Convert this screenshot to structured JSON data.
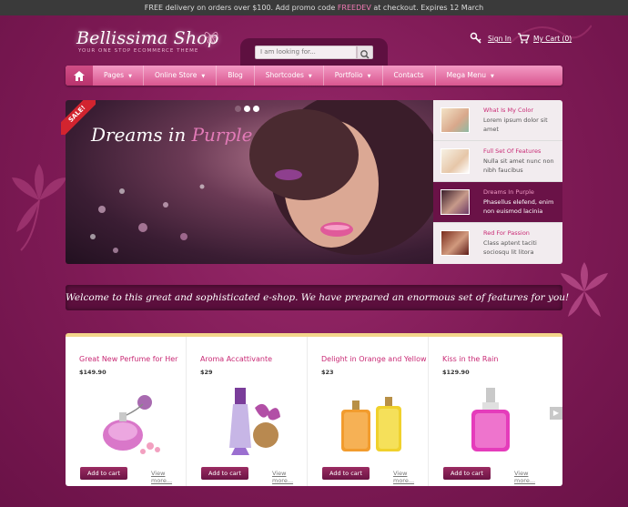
{
  "topbar": {
    "before": "FREE delivery on orders over $100. Add promo code ",
    "code": "FREEDEV",
    "after": " at checkout. Expires 12 March"
  },
  "logo": {
    "name": "Bellissima Shop",
    "tagline": "YOUR ONE STOP ECOMMERCE THEME"
  },
  "search": {
    "placeholder": "I am looking for...",
    "icon": "search-icon"
  },
  "header": {
    "signin": "Sign In",
    "cart": "My Cart (0)"
  },
  "nav": [
    {
      "label": "Pages",
      "dropdown": true
    },
    {
      "label": "Online Store",
      "dropdown": true
    },
    {
      "label": "Blog",
      "dropdown": false
    },
    {
      "label": "Shortcodes",
      "dropdown": true
    },
    {
      "label": "Portfolio",
      "dropdown": true
    },
    {
      "label": "Contacts",
      "dropdown": false
    },
    {
      "label": "Mega Menu",
      "dropdown": true
    }
  ],
  "slider": {
    "sale": "SALE!",
    "title_main": "Dreams in ",
    "title_accent": "Purple",
    "thumbs": [
      {
        "title": "What Is My Color",
        "desc": "Lorem ipsum dolor sit amet"
      },
      {
        "title": "Full Set Of Features",
        "desc": "Nulla sit amet nunc non nibh faucibus"
      },
      {
        "title": "Dreams In Purple",
        "desc": "Phasellus elefend, enim non euismod lacinia"
      },
      {
        "title": "Red For Passion",
        "desc": "Class aptent taciti sociosqu lit litora"
      }
    ]
  },
  "welcome": "Welcome to this great and sophisticated e-shop. We have prepared an enormous set of features for you!",
  "products": [
    {
      "name": "Great New Perfume for Her",
      "price": "$149.90",
      "cart": "Add to cart",
      "more": "View more..."
    },
    {
      "name": "Aroma Accattivante",
      "price": "$29",
      "cart": "Add to cart",
      "more": "View more..."
    },
    {
      "name": "Delight in Orange and Yellow",
      "price": "$23",
      "cart": "Add to cart",
      "more": "View more..."
    },
    {
      "name": "Kiss in the Rain",
      "price": "$129.90",
      "cart": "Add to cart",
      "more": "View more..."
    }
  ],
  "colors": {
    "accent": "#c92a75",
    "background": "#7e1a55",
    "nav": "#e46da3"
  }
}
